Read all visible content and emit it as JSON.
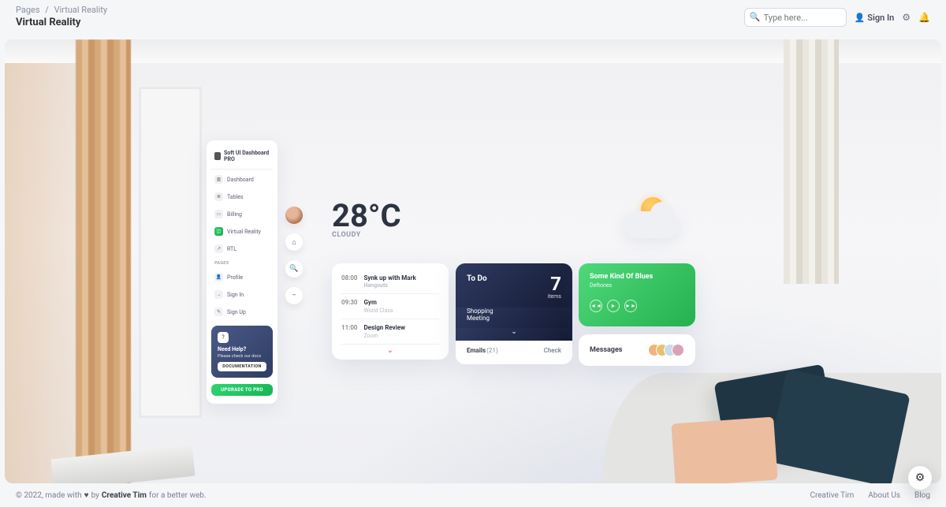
{
  "breadcrumb": {
    "root": "Pages",
    "current": "Virtual Reality"
  },
  "page_title": "Virtual Reality",
  "search": {
    "placeholder": "Type here..."
  },
  "signin_label": "Sign In",
  "sidebar": {
    "brand": "Soft UI Dashboard PRO",
    "items": [
      {
        "label": "Dashboard",
        "icon": "▥"
      },
      {
        "label": "Tables",
        "icon": "≣"
      },
      {
        "label": "Billing",
        "icon": "▭"
      },
      {
        "label": "Virtual Reality",
        "icon": "◫"
      },
      {
        "label": "RTL",
        "icon": "↗"
      }
    ],
    "section_label": "PAGES",
    "pages": [
      {
        "label": "Profile",
        "icon": "👤"
      },
      {
        "label": "Sign In",
        "icon": "→"
      },
      {
        "label": "Sign Up",
        "icon": "✎"
      }
    ],
    "help": {
      "title": "Need Help?",
      "sub": "Please check our docs",
      "button": "DOCUMENTATION"
    },
    "upgrade": "UPGRADE TO PRO"
  },
  "weather": {
    "temp": "28°C",
    "condition": "CLOUDY"
  },
  "schedule": [
    {
      "time": "08:00",
      "title": "Synk up with Mark",
      "tag": "Hangouts"
    },
    {
      "time": "09:30",
      "title": "Gym",
      "sub": "World Class"
    },
    {
      "time": "11:00",
      "title": "Design Review",
      "sub": "Zoom"
    }
  ],
  "todo": {
    "label": "To Do",
    "count": "7",
    "count_label": "items",
    "lines": [
      "Shopping",
      "Meeting"
    ],
    "emails_label": "Emails",
    "emails_count": "(21)",
    "check_label": "Check"
  },
  "music": {
    "title": "Some Kind Of Blues",
    "artist": "Deftones"
  },
  "messages": {
    "label": "Messages"
  },
  "footer": {
    "prefix": "© 2022, made with",
    "by": "by",
    "author": "Creative Tim",
    "suffix": "for a better web.",
    "links": [
      "Creative Tim",
      "About Us",
      "Blog"
    ]
  }
}
